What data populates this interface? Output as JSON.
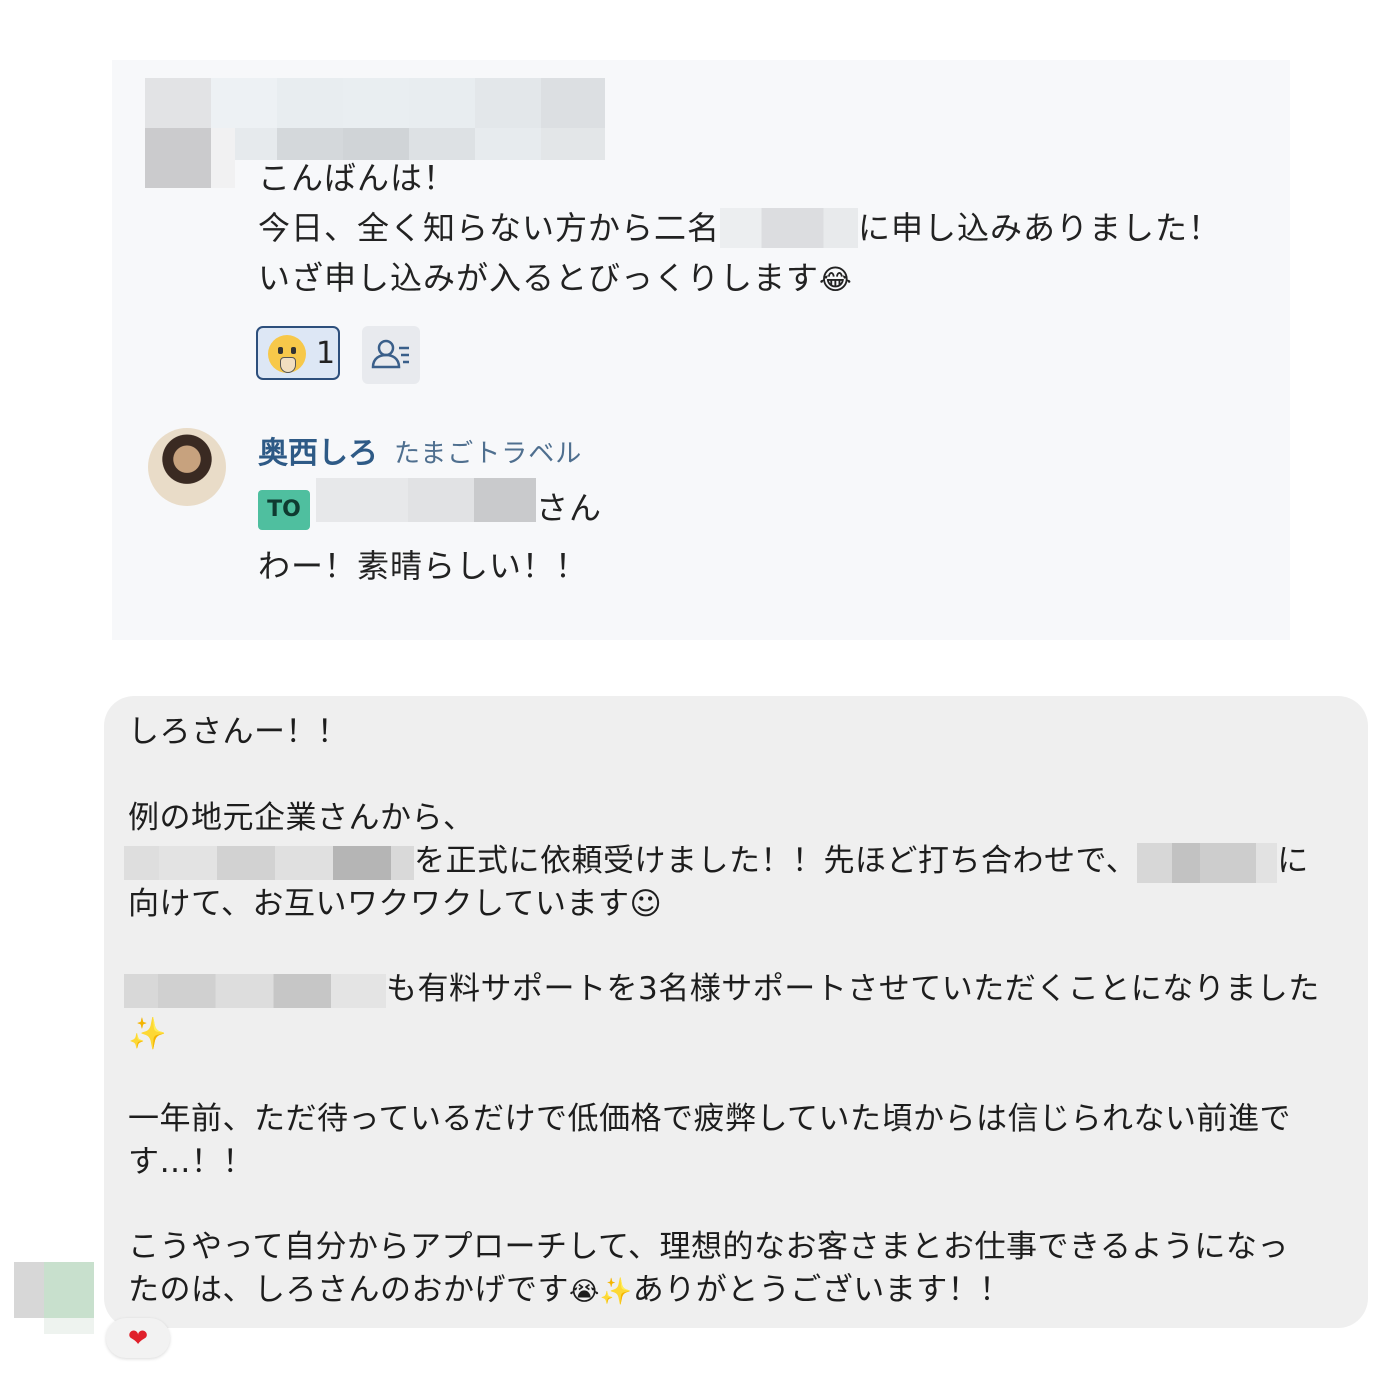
{
  "quoted_card": {
    "greeting": "こんばんは！",
    "line2_a": "今日、全く知らない方から二名",
    "line2_b": "に申し込みありました！",
    "line3": "いざ申し込みが入るとびっくりします",
    "line3_emoji": "😂",
    "reaction": {
      "emoji_icon": "hugging-face-icon",
      "count": "1"
    },
    "reader_icon": "read-status-icon",
    "reply": {
      "sender_name": "奥西しろ",
      "sender_org": "たまごトラベル",
      "to_badge": "TO",
      "to_suffix": "さん",
      "message": "わー！素晴らしい！！"
    }
  },
  "bubble": {
    "line1": "しろさんー！！",
    "line2": "例の地元企業さんから、",
    "line3_a": "を正式に依頼受けました！！先ほど打ち合わせで、",
    "line3_b": "に",
    "line4": "向けて、お互いワクワクしています☺",
    "line5": "も有料サポートを3名様サポートさせていただくことになりました",
    "line6": "✨",
    "line7": "一年前、ただ待っているだけで低価格で疲弊していた頃からは信じられない前進で",
    "line8": "す…！！",
    "line9": "こうやって自分からアプローチして、理想的なお客さまとお仕事できるようになっ",
    "line10_a": "たのは、しろさんのおかげです",
    "line10_emoji": "😭✨",
    "line10_b": "ありがとうございます！！",
    "heart_reaction": "❤"
  },
  "colors": {
    "sender_name": "#2e5a86",
    "to_badge": "#4fbf9f",
    "bubble_bg": "#efefef",
    "card_bg": "#f7f8fa"
  }
}
